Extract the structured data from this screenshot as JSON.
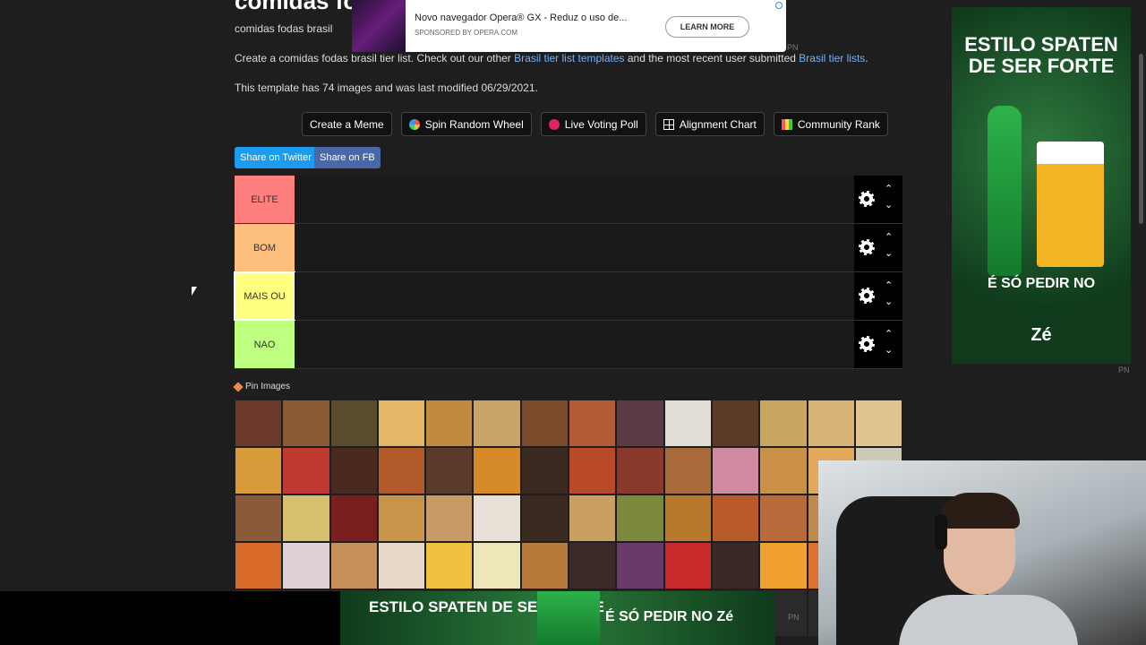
{
  "page": {
    "title": "comidas fodas brasil Tier List",
    "subtitle": "comidas fodas brasil",
    "desc_prefix": "Create a comidas fodas brasil tier list. Check out our other ",
    "desc_link1": "Brasil tier list templates",
    "desc_mid": " and the most recent user submitted ",
    "desc_link2": "Brasil tier lists",
    "desc_suffix": ".",
    "info": "This template has 74 images and was last modified 06/29/2021."
  },
  "top_ad": {
    "title": "Novo navegador Opera® GX - Reduz o uso de...",
    "sponsor": "SPONSORED BY OPERA.COM",
    "button": "LEARN MORE",
    "pn": "PN"
  },
  "actions": [
    {
      "label": "Create a Meme",
      "icon": "none"
    },
    {
      "label": "Spin Random Wheel",
      "icon": "wheel-icon"
    },
    {
      "label": "Live Voting Poll",
      "icon": "dot-icon"
    },
    {
      "label": "Alignment Chart",
      "icon": "grid-icon"
    },
    {
      "label": "Community Rank",
      "icon": "rank-icon"
    }
  ],
  "share": {
    "twitter": "Share on Twitter",
    "fb": "Share on FB"
  },
  "tiers": [
    {
      "label": "ELITE",
      "color": "#ff7f7f"
    },
    {
      "label": "BOM",
      "color": "#ffbf7f"
    },
    {
      "label": "MAIS OU",
      "color": "#ffff7f"
    },
    {
      "label": "NAO",
      "color": "#bfff7f"
    }
  ],
  "controls": {
    "up": "⌃",
    "down": "⌄"
  },
  "pin_label": "Pin Images",
  "right_ad": {
    "headline": "ESTILO SPATEN DE SER FORTE",
    "tagline": "É SÓ PEDIR NO",
    "brand": "Zé",
    "pn": "PN"
  },
  "bottom_ad": {
    "headline": "ESTILO SPATEN DE SER FORTE",
    "tagline": "É SÓ PEDIR NO Zé",
    "pn": "PN"
  },
  "image_colors": [
    "#6b3a2a",
    "#8c5a34",
    "#5a4a2e",
    "#e3b766",
    "#c28a3e",
    "#c9a46a",
    "#7a4a2a",
    "#b35a36",
    "#5a3a44",
    "#e0ddd6",
    "#5c3a28",
    "#c8a560",
    "#d8b476",
    "#e2c48e",
    "#d99a3a",
    "#c13a32",
    "#4a2a1e",
    "#b25a2a",
    "#5a3a2a",
    "#d68a2a",
    "#3a2a22",
    "#b84a2a",
    "#8a3a2a",
    "#a86a3a",
    "#d08aa0",
    "#c99046",
    "#e4a85a",
    "#cfcab8",
    "#8a5a3a",
    "#d6c070",
    "#7a1e1e",
    "#c8944a",
    "#c89a66",
    "#e8e0d6",
    "#3a2a22",
    "#c9a060",
    "#7a8a3a",
    "#b87a2a",
    "#b85a2a",
    "#b86a3a",
    "#c08a4a",
    "#6a8a3a",
    "#d86a2a",
    "#e0d0d8",
    "#c6905a",
    "#e8d8c8",
    "#f0c040",
    "#ece6b8",
    "#b87a3a",
    "#3a2a28",
    "#6a3a6a",
    "#c82a2a",
    "#3a2a26",
    "#f0a030",
    "#e07030",
    "#a8b840",
    "#3a2a22",
    "#3a2a22",
    "#3a2a22",
    "#3a2a22",
    "#2a2a2a",
    "#2a2a2a",
    "#2a2a2a",
    "#2a2a2a",
    "#2a2a2a",
    "#2a2a2a",
    "#2a2a2a",
    "#2a2a2a",
    "#2a2a2a",
    "#2a2a2a"
  ]
}
